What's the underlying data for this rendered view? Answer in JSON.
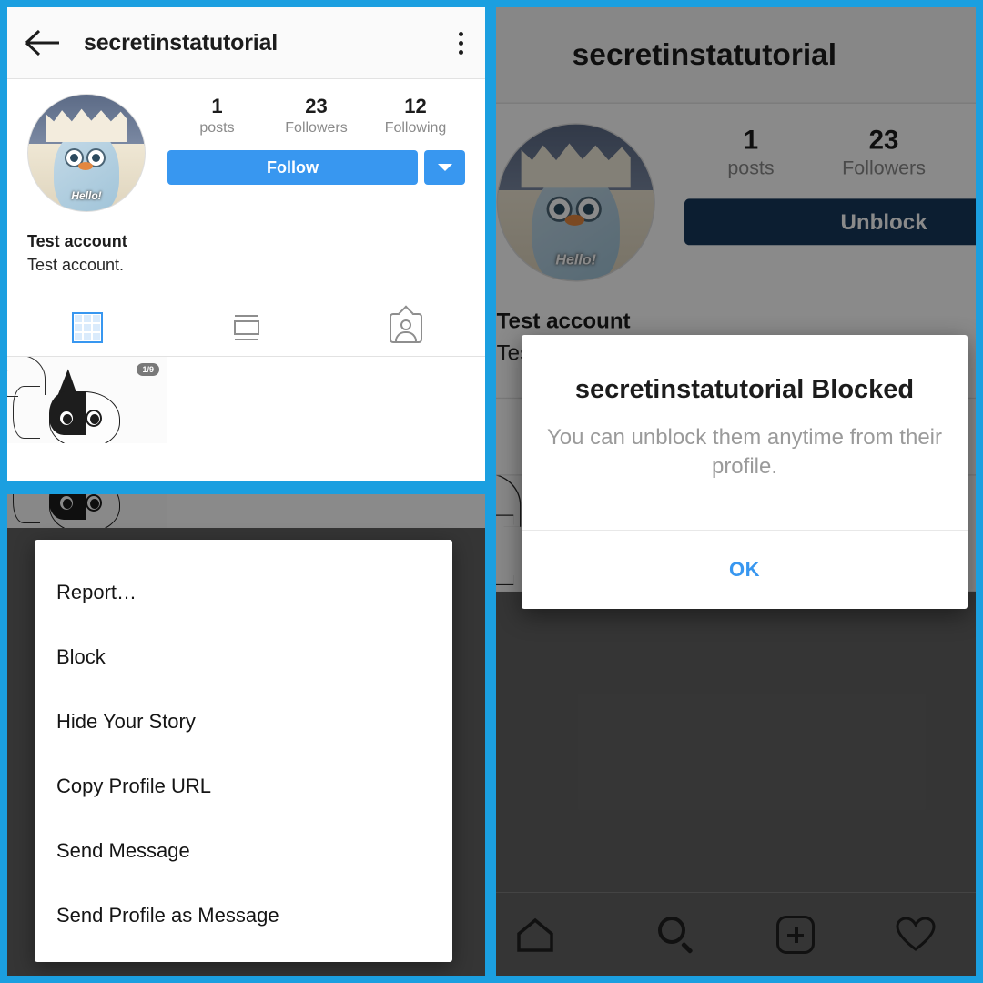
{
  "collage": {
    "frame_color": "#1b9fe0",
    "panels": [
      "profile-screen",
      "options-menu-screen",
      "blocked-confirmation-screen"
    ]
  },
  "profile": {
    "header": {
      "back_icon": "back-arrow-icon",
      "title": "secretinstatutorial",
      "overflow_icon": "three-dot-menu-icon"
    },
    "avatar": {
      "alt": "penguin-profile-photo",
      "caption": "Hello!"
    },
    "stats": [
      {
        "num": "1",
        "label": "posts"
      },
      {
        "num": "23",
        "label": "Followers"
      },
      {
        "num": "12",
        "label": "Following"
      }
    ],
    "follow_label": "Follow",
    "unblock_label": "Unblock",
    "caret_icon": "chevron-down-icon",
    "full_name": "Test account",
    "bio": "Test account.",
    "tabs": [
      {
        "icon": "grid-view-icon",
        "active": true
      },
      {
        "icon": "list-view-icon",
        "active": false
      },
      {
        "icon": "tagged-photos-icon",
        "active": false
      }
    ],
    "posts": [
      {
        "alt": "cat-line-art-post",
        "badge": "1/9"
      }
    ],
    "accent_color": "#3897f0",
    "dimmed_button_color": "#17395c"
  },
  "options_menu": {
    "items": [
      "Report…",
      "Block",
      "Hide Your Story",
      "Copy Profile URL",
      "Send Message",
      "Send Profile as Message"
    ]
  },
  "blocked_dialog": {
    "title": "secretinstatutorial Blocked",
    "message": "You can unblock them anytime from their profile.",
    "ok_label": "OK",
    "ok_color": "#3897f0"
  },
  "bottom_nav": {
    "items": [
      {
        "icon": "home-icon"
      },
      {
        "icon": "search-icon"
      },
      {
        "icon": "add-post-icon"
      },
      {
        "icon": "activity-heart-icon"
      }
    ]
  }
}
